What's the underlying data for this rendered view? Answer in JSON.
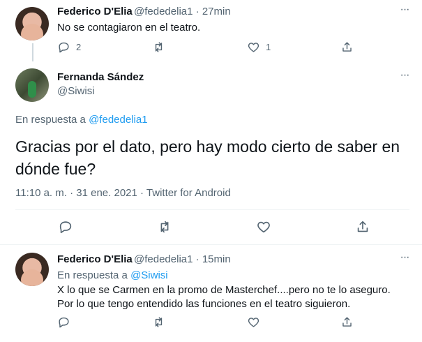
{
  "tweet1": {
    "author_name": "Federico D'Elia",
    "author_handle": "@fededelia1",
    "time": "27min",
    "text": "No se contagiaron en el teatro.",
    "reply_count": "2",
    "like_count": "1"
  },
  "tweet2": {
    "author_name": "Fernanda Sández",
    "author_handle": "@Siwisi",
    "reply_prefix": "En respuesta a ",
    "reply_to": "@fededelia1",
    "text": "Gracias por el dato, pero hay modo cierto de saber en dónde fue?",
    "timestamp": "11:10 a. m. · 31 ene. 2021 · ",
    "source": "Twitter for Android"
  },
  "tweet3": {
    "author_name": "Federico D'Elia",
    "author_handle": "@fededelia1",
    "time": "15min",
    "reply_prefix": "En respuesta a ",
    "reply_to": "@Siwisi",
    "text": "X lo que se Carmen en la promo de Masterchef....pero no te lo aseguro. Por lo que tengo entendido las funciones en el teatro siguieron."
  },
  "colors": {
    "link": "#1d9bf0",
    "muted": "#536471",
    "text": "#0f1419"
  }
}
